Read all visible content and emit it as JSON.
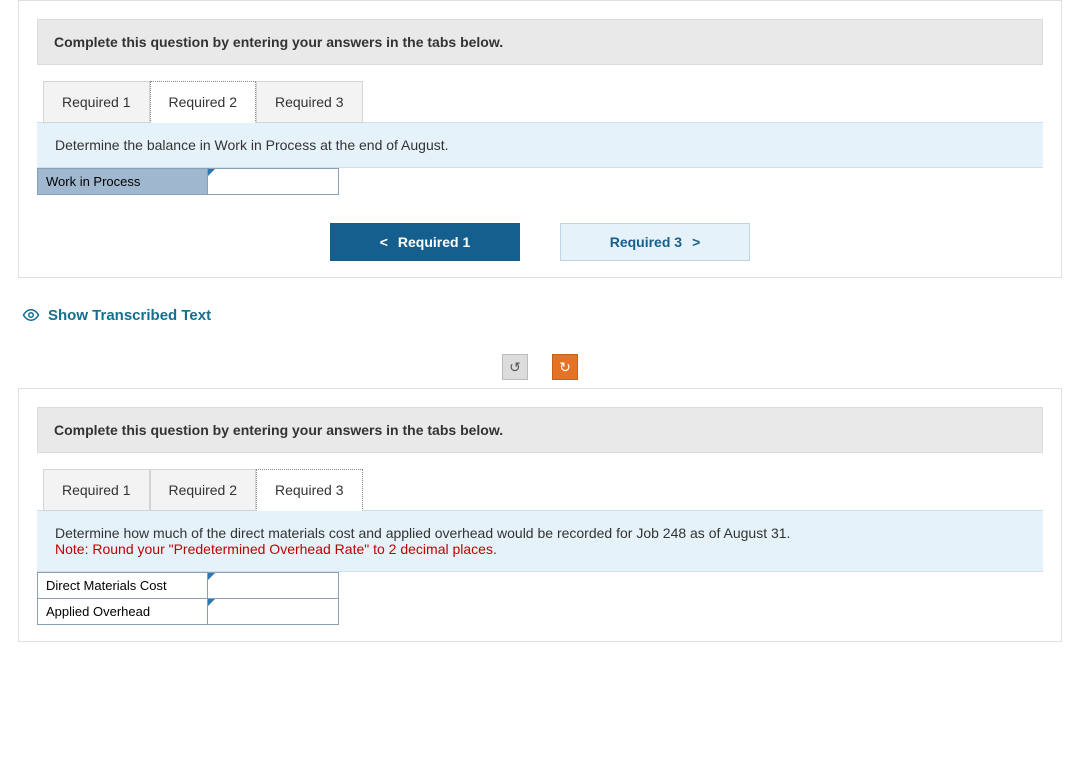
{
  "panel1": {
    "instruction": "Complete this question by entering your answers in the tabs below.",
    "tabs": [
      {
        "label": "Required 1",
        "active": false
      },
      {
        "label": "Required 2",
        "active": true
      },
      {
        "label": "Required 3",
        "active": false
      }
    ],
    "question": "Determine the balance in Work in Process at the end of August.",
    "rows": [
      {
        "label": "Work in Process",
        "value": ""
      }
    ],
    "nav": {
      "prev": "Required 1",
      "next": "Required 3"
    }
  },
  "showTranscribed": "Show Transcribed Text",
  "undoGlyph": "↺",
  "redoGlyph": "↻",
  "panel2": {
    "instruction": "Complete this question by entering your answers in the tabs below.",
    "tabs": [
      {
        "label": "Required 1",
        "active": false
      },
      {
        "label": "Required 2",
        "active": false
      },
      {
        "label": "Required 3",
        "active": true
      }
    ],
    "question": "Determine how much of the direct materials cost and applied overhead would be recorded for Job 248 as of August 31.",
    "note": "Note: Round your \"Predetermined Overhead Rate\" to 2 decimal places.",
    "rows": [
      {
        "label": "Direct Materials Cost",
        "value": ""
      },
      {
        "label": "Applied Overhead",
        "value": ""
      }
    ]
  }
}
